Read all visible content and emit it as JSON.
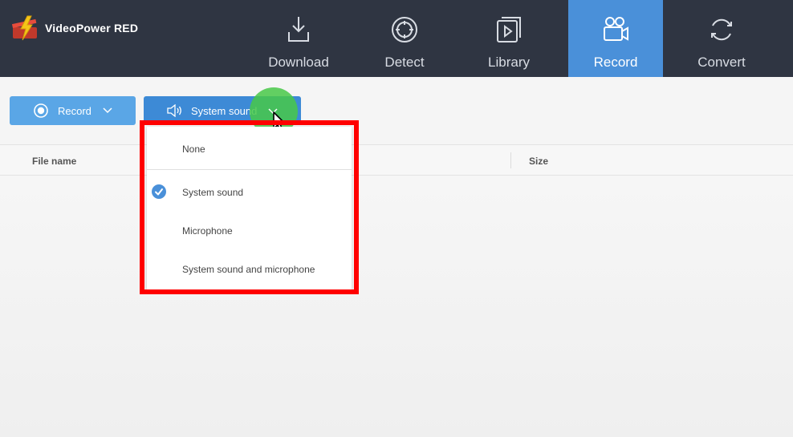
{
  "app": {
    "name": "VideoPower RED"
  },
  "nav": {
    "tabs": [
      {
        "label": "Download",
        "icon": "download-icon"
      },
      {
        "label": "Detect",
        "icon": "target-icon"
      },
      {
        "label": "Library",
        "icon": "library-play-icon"
      },
      {
        "label": "Record",
        "icon": "video-camera-icon",
        "active": true
      },
      {
        "label": "Convert",
        "icon": "convert-cycle-icon"
      }
    ]
  },
  "toolbar": {
    "record_label": "Record",
    "sound_label": "System sound"
  },
  "table": {
    "columns": [
      "File name",
      "Size"
    ]
  },
  "sound_menu": {
    "options": [
      {
        "label": "None",
        "selected": false
      },
      {
        "label": "System sound",
        "selected": true
      },
      {
        "label": "Microphone",
        "selected": false
      },
      {
        "label": "System sound and microphone",
        "selected": false
      }
    ]
  },
  "colors": {
    "header_bg": "#2f3542",
    "active_tab": "#4a90d9",
    "highlight_frame": "#ff0000",
    "cursor_glow": "#48c848"
  }
}
